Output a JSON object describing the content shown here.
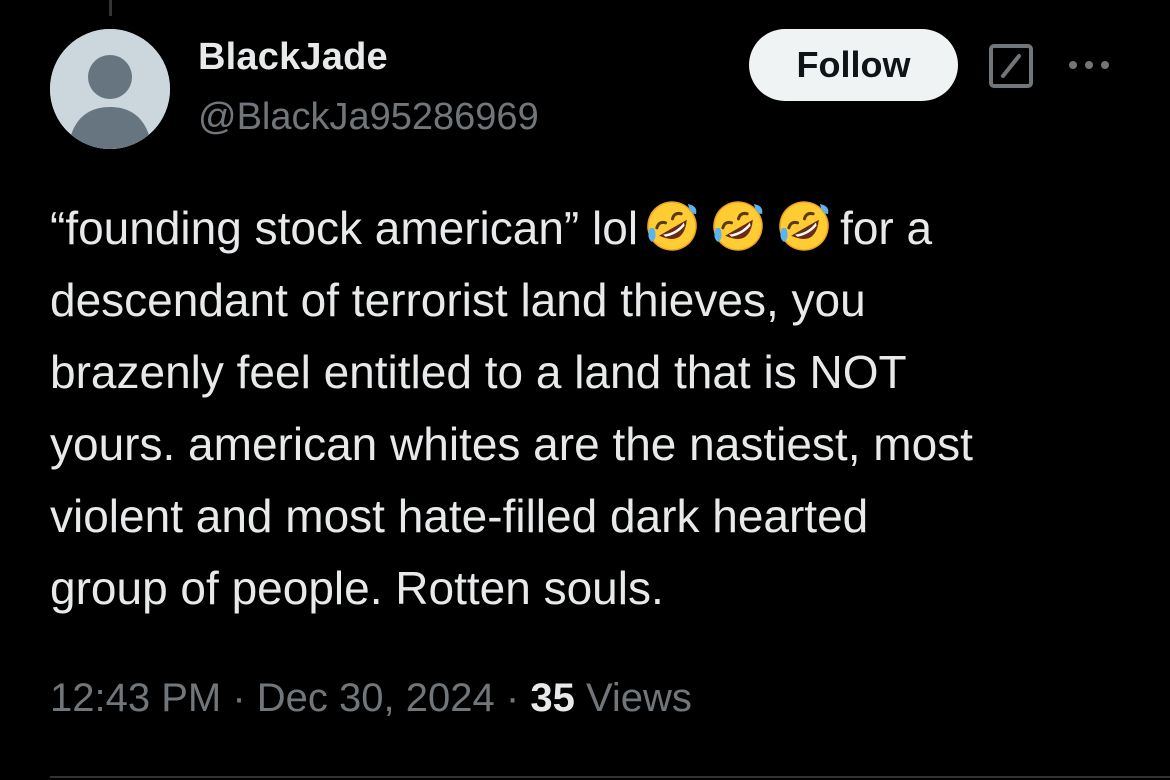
{
  "tweet": {
    "author": {
      "display_name": "BlackJade",
      "handle": "@BlackJa95286969",
      "avatar_icon": "default-avatar-icon"
    },
    "follow_label": "Follow",
    "actions": {
      "grok_icon": "grok-icon",
      "more_icon": "more-icon"
    },
    "text": {
      "line1_before": "“founding stock american” lol",
      "line1_emojis": [
        "rolling-on-floor-laughing",
        "rolling-on-floor-laughing",
        "rolling-on-floor-laughing"
      ],
      "line1_after": "for a",
      "line2": "descendant of terrorist land thieves, you",
      "line3": "brazenly feel entitled to a land that is NOT",
      "line4": "yours. american whites are the nastiest, most",
      "line5": "violent and most hate-filled dark hearted",
      "line6": "group of people. Rotten souls."
    },
    "meta": {
      "time": "12:43 PM",
      "separator": "·",
      "date": "Dec 30, 2024",
      "views_count": "35",
      "views_label": "Views"
    }
  },
  "colors": {
    "background": "#000000",
    "primary_text": "#e7e9ea",
    "secondary_text": "#71767b",
    "follow_bg": "#eff3f4",
    "follow_text": "#0f1419"
  }
}
